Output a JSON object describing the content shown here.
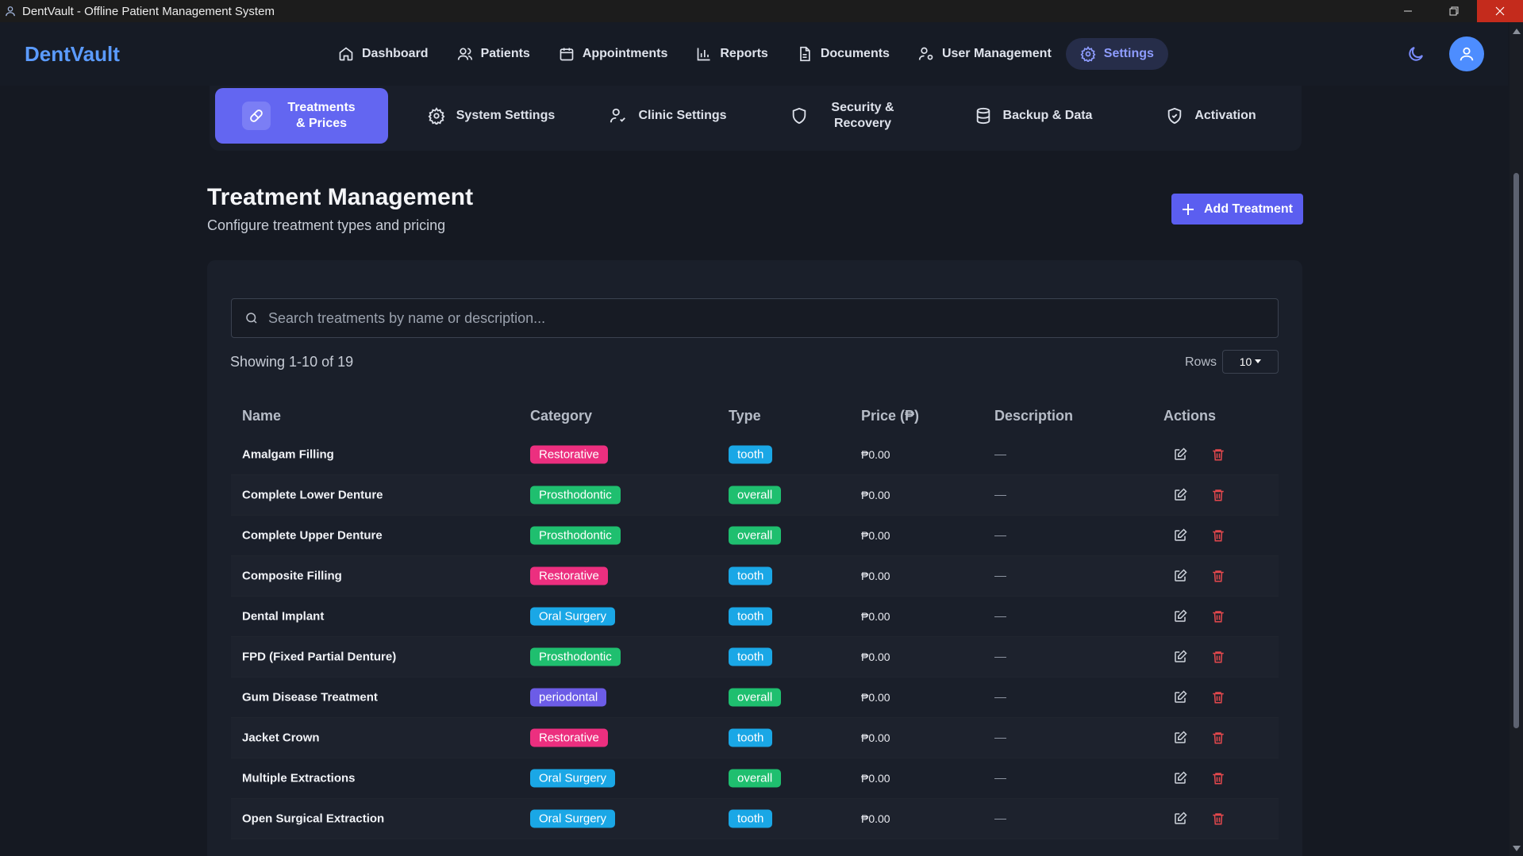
{
  "window": {
    "title": "DentVault - Offline Patient Management System"
  },
  "brand": "DentVault",
  "nav": [
    {
      "label": "Dashboard",
      "icon": "home-icon"
    },
    {
      "label": "Patients",
      "icon": "users-icon"
    },
    {
      "label": "Appointments",
      "icon": "calendar-icon"
    },
    {
      "label": "Reports",
      "icon": "bar-chart-icon"
    },
    {
      "label": "Documents",
      "icon": "document-icon"
    },
    {
      "label": "User Management",
      "icon": "user-cog-icon"
    },
    {
      "label": "Settings",
      "icon": "gear-icon",
      "active": true
    }
  ],
  "tabs": [
    {
      "label": "Treatments & Prices",
      "icon": "pill-icon",
      "active": true
    },
    {
      "label": "System Settings",
      "icon": "gear-icon"
    },
    {
      "label": "Clinic Settings",
      "icon": "user-check-icon"
    },
    {
      "label": "Security & Recovery",
      "icon": "shield-icon"
    },
    {
      "label": "Backup & Data",
      "icon": "database-icon"
    },
    {
      "label": "Activation",
      "icon": "shield-check-icon"
    }
  ],
  "header": {
    "title": "Treatment Management",
    "subtitle": "Configure treatment types and pricing",
    "add_button": "Add Treatment"
  },
  "search": {
    "placeholder": "Search treatments by name or description..."
  },
  "pagination": {
    "showing": "Showing 1-10 of 19",
    "rows_label": "Rows",
    "rows_value": "10"
  },
  "table": {
    "columns": [
      "Name",
      "Category",
      "Type",
      "Price (₱)",
      "Description",
      "Actions"
    ],
    "rows": [
      {
        "name": "Amalgam Filling",
        "category": "Restorative",
        "type": "tooth",
        "price": "₱0.00",
        "description": "—"
      },
      {
        "name": "Complete Lower Denture",
        "category": "Prosthodontic",
        "type": "overall",
        "price": "₱0.00",
        "description": "—"
      },
      {
        "name": "Complete Upper Denture",
        "category": "Prosthodontic",
        "type": "overall",
        "price": "₱0.00",
        "description": "—"
      },
      {
        "name": "Composite Filling",
        "category": "Restorative",
        "type": "tooth",
        "price": "₱0.00",
        "description": "—"
      },
      {
        "name": "Dental Implant",
        "category": "Oral Surgery",
        "type": "tooth",
        "price": "₱0.00",
        "description": "—"
      },
      {
        "name": "FPD (Fixed Partial Denture)",
        "category": "Prosthodontic",
        "type": "tooth",
        "price": "₱0.00",
        "description": "—"
      },
      {
        "name": "Gum Disease Treatment",
        "category": "periodontal",
        "type": "overall",
        "price": "₱0.00",
        "description": "—"
      },
      {
        "name": "Jacket Crown",
        "category": "Restorative",
        "type": "tooth",
        "price": "₱0.00",
        "description": "—"
      },
      {
        "name": "Multiple Extractions",
        "category": "Oral Surgery",
        "type": "overall",
        "price": "₱0.00",
        "description": "—"
      },
      {
        "name": "Open Surgical Extraction",
        "category": "Oral Surgery",
        "type": "tooth",
        "price": "₱0.00",
        "description": "—"
      }
    ]
  },
  "colors": {
    "accent": "#6366f1",
    "brand": "#5b9bff",
    "Restorative": "#ec2f7f",
    "Prosthodontic": "#1fbf6f",
    "Oral Surgery": "#1aa7e6",
    "periodontal": "#6c5ce7",
    "tooth": "#1aa7e6",
    "overall": "#1fbf6f",
    "delete": "#e5484d"
  }
}
